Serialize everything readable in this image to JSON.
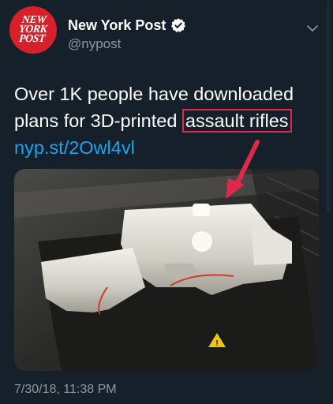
{
  "tweet": {
    "avatar_text": "NEW\nYORK\nPOST",
    "display_name": "New York Post",
    "handle": "@nypost",
    "text_before": "Over 1K people have downloaded plans for 3D-printed ",
    "text_highlight": "assault rifles",
    "link": "nyp.st/2Owl4vl",
    "timestamp": "7/30/18, 11:38 PM"
  },
  "icons": {
    "verified": "verified-badge-icon",
    "menu": "chevron-down-icon",
    "annotation_arrow": "red-arrow",
    "warning": "warning-triangle-icon"
  },
  "colors": {
    "background": "#15202b",
    "text": "#ffffff",
    "secondary_text": "#8899a6",
    "link": "#1da1f2",
    "annotation": "#e0284a",
    "brand": "#d6202a"
  }
}
